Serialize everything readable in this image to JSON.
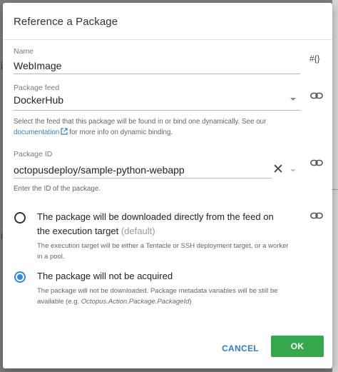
{
  "dialog": {
    "title": "Reference a Package"
  },
  "name_field": {
    "label": "Name",
    "value": "WebImage",
    "side_icon": "#{}"
  },
  "feed_field": {
    "label": "Package feed",
    "value": "DockerHub",
    "help_prefix": "Select the feed that this package will be found in or bind one dynamically. See our",
    "help_link": "documentation",
    "help_suffix": "for more info on dynamic binding."
  },
  "package_id_field": {
    "label": "Package ID",
    "value": "octopusdeploy/sample-python-webapp",
    "help": "Enter the ID of the package."
  },
  "acquisition": {
    "option_download": {
      "label": "The package will be downloaded directly from the feed on the execution target",
      "default_tag": "(default)",
      "help": "The execution target will be either a Tentacle or SSH deployment target, or a worker in a pool."
    },
    "option_not_acquired": {
      "label": "The package will not be acquired",
      "help_prefix": "The package will not be downloaded. Package metadata variables will be still be available (e.g.",
      "help_variable": "Octopus.Action.Package.PackageId",
      "help_suffix": ")"
    }
  },
  "buttons": {
    "cancel": "CANCEL",
    "ok": "OK"
  },
  "colors": {
    "accent_blue": "#2f8ad8",
    "link_blue": "#2f7fc1",
    "ok_green": "#35a84e"
  },
  "icons": {
    "bind": "link-icon",
    "variable": "variable-icon",
    "clear": "close-icon",
    "external": "external-link-icon"
  }
}
